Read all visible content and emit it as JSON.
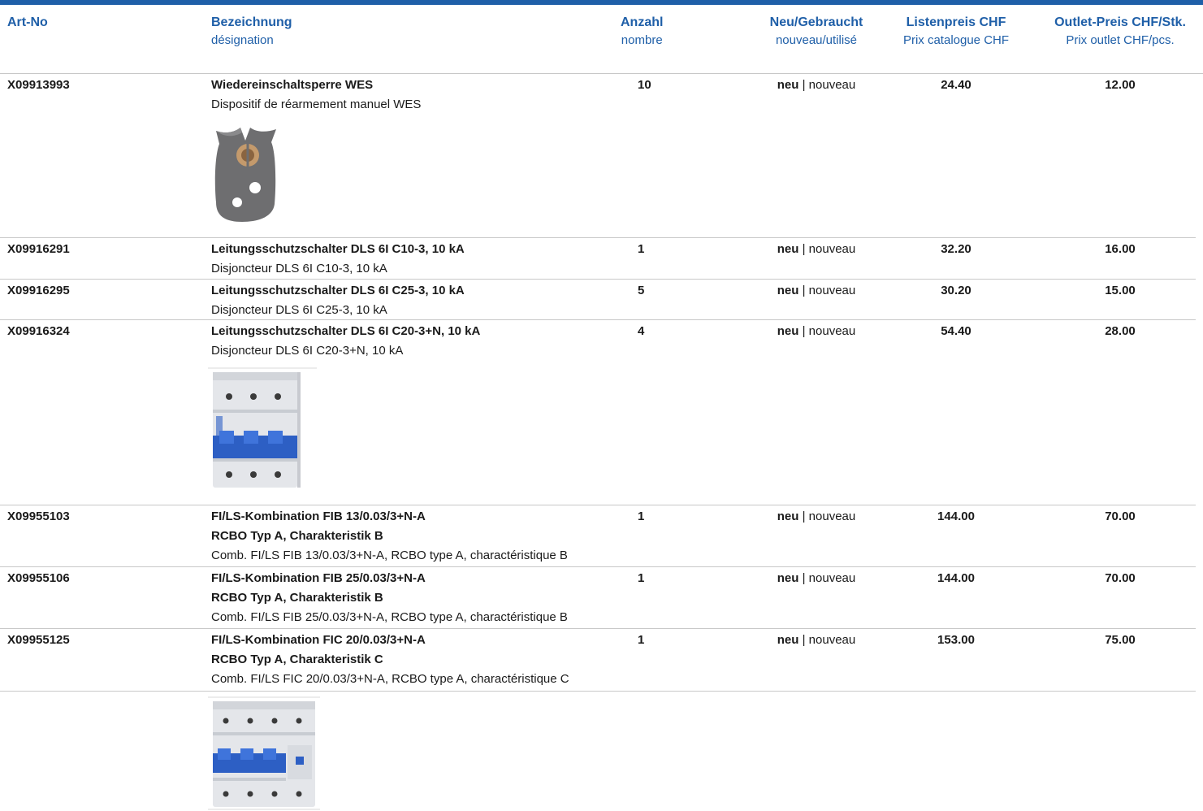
{
  "header": {
    "art": "Art-No",
    "bez_de": "Bezeichnung",
    "bez_fr": "désignation",
    "anz_de": "Anzahl",
    "anz_fr": "nombre",
    "neu_de": "Neu/Gebraucht",
    "neu_fr": "nouveau/utilisé",
    "lp_de": "Listenpreis CHF",
    "lp_fr": "Prix catalogue CHF",
    "op_de": "Outlet-Preis CHF/Stk.",
    "op_fr": "Prix outlet CHF/pcs."
  },
  "rows": [
    {
      "art": "X09913993",
      "de": "Wiedereinschaltsperre WES",
      "fr": "Dispositif de réarmement manuel WES",
      "qty": "10",
      "state_bold": "neu",
      "state_rest": " | nouveau",
      "list_price": "24.40",
      "outlet_price": "12.00"
    },
    {
      "art": "X09916291",
      "de": "Leitungsschutzschalter DLS 6I C10-3, 10 kA",
      "fr": "Disjoncteur DLS 6I C10-3, 10 kA",
      "qty": "1",
      "state_bold": "neu",
      "state_rest": " | nouveau",
      "list_price": "32.20",
      "outlet_price": "16.00"
    },
    {
      "art": "X09916295",
      "de": "Leitungsschutzschalter DLS 6I C25-3, 10 kA",
      "fr": "Disjoncteur DLS 6I C25-3, 10 kA",
      "qty": "5",
      "state_bold": "neu",
      "state_rest": " | nouveau",
      "list_price": "30.20",
      "outlet_price": "15.00"
    },
    {
      "art": "X09916324",
      "de": "Leitungsschutzschalter DLS 6I C20-3+N, 10 kA",
      "fr": "Disjoncteur DLS 6I C20-3+N, 10 kA",
      "qty": "4",
      "state_bold": "neu",
      "state_rest": " | nouveau",
      "list_price": "54.40",
      "outlet_price": "28.00"
    },
    {
      "art": "X09955103",
      "de": "FI/LS-Kombination FIB 13/0.03/3+N-A",
      "de2": "RCBO Typ A, Charakteristik B",
      "fr": "Comb. FI/LS FIB 13/0.03/3+N-A, RCBO type A, charactéristique B",
      "qty": "1",
      "state_bold": "neu",
      "state_rest": " | nouveau",
      "list_price": "144.00",
      "outlet_price": "70.00"
    },
    {
      "art": "X09955106",
      "de": "FI/LS-Kombination FIB 25/0.03/3+N-A",
      "de2": "RCBO Typ A, Charakteristik B",
      "fr": "Comb. FI/LS FIB 25/0.03/3+N-A, RCBO type A, charactéristique B",
      "qty": "1",
      "state_bold": "neu",
      "state_rest": " | nouveau",
      "list_price": "144.00",
      "outlet_price": "70.00"
    },
    {
      "art": "X09955125",
      "de": "FI/LS-Kombination FIC 20/0.03/3+N-A",
      "de2": "RCBO Typ A, Charakteristik C",
      "fr": "Comb. FI/LS FIC 20/0.03/3+N-A, RCBO type A, charactéristique C",
      "qty": "1",
      "state_bold": "neu",
      "state_rest": " | nouveau",
      "list_price": "153.00",
      "outlet_price": "75.00"
    }
  ],
  "colors": {
    "brand_blue": "#1f5fa8",
    "rule_gray": "#c8c8c8",
    "switch_blue": "#2d5fc4"
  }
}
